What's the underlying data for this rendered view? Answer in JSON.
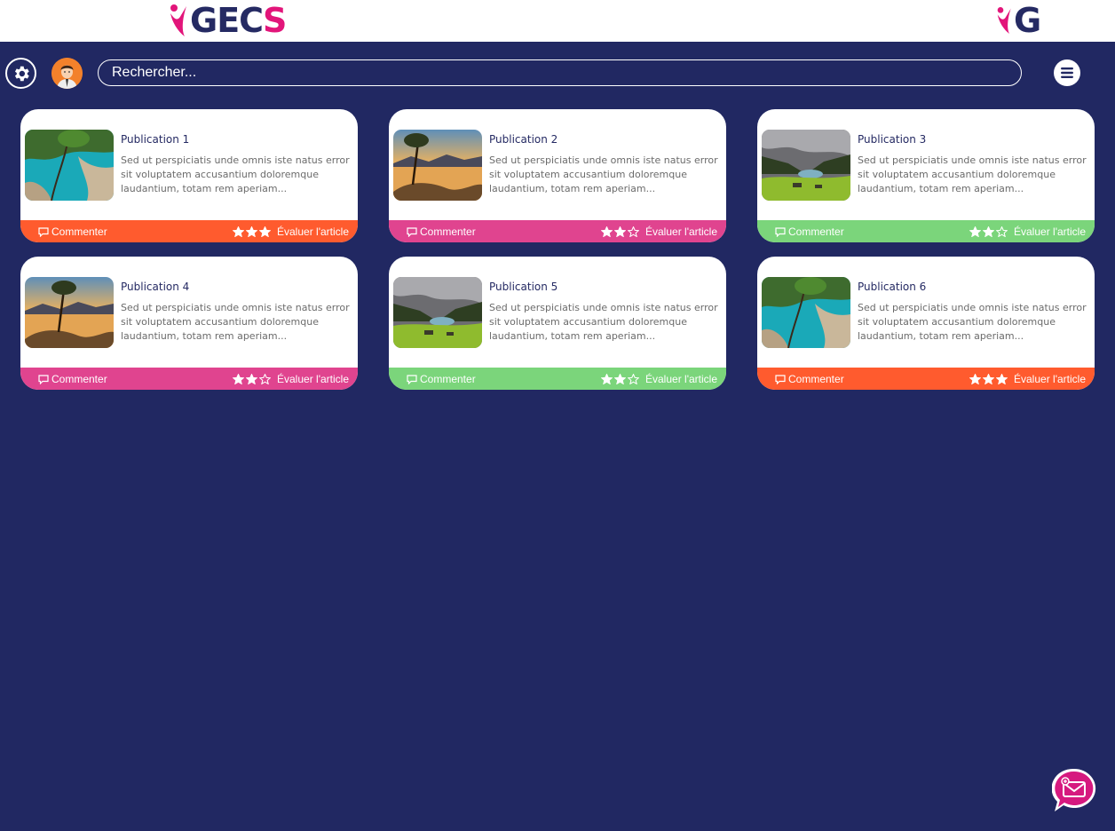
{
  "header": {
    "logo_text_dark": "GEC",
    "logo_text_pink": "S",
    "logo_small_text": "G"
  },
  "toolbar": {
    "search_placeholder": "Rechercher...",
    "settings_icon": "gear-icon",
    "menu_icon": "hamburger-icon"
  },
  "colors": {
    "background": "#212862",
    "orange": "#ff5b2e",
    "pink": "#e0448f",
    "green": "#7bd57b",
    "brand_pink": "#e2157a",
    "brand_navy": "#252a63"
  },
  "publications": [
    {
      "title": "Publication 1",
      "description": "Sed ut perspiciatis unde omnis iste natus error sit voluptatem accusantium doloremque laudantium, totam rem aperiam...",
      "comment_label": "Commenter",
      "rate_label": "Évaluer l'article",
      "rating": 3,
      "max_rating": 3,
      "footer_color": "#ff5b2e",
      "image": "coast-cove"
    },
    {
      "title": "Publication 2",
      "description": "Sed ut perspiciatis unde omnis iste natus error sit voluptatem accusantium doloremque laudantium, totam rem aperiam...",
      "comment_label": "Commenter",
      "rate_label": "Évaluer l'article",
      "rating": 2,
      "max_rating": 3,
      "footer_color": "#e0448f",
      "image": "lake-sunset"
    },
    {
      "title": "Publication 3",
      "description": "Sed ut perspiciatis unde omnis iste natus error sit voluptatem accusantium doloremque laudantium, totam rem aperiam...",
      "comment_label": "Commenter",
      "rate_label": "Évaluer l'article",
      "rating": 2,
      "max_rating": 3,
      "footer_color": "#7bd57b",
      "image": "green-valley"
    },
    {
      "title": "Publication 4",
      "description": "Sed ut perspiciatis unde omnis iste natus error sit voluptatem accusantium doloremque laudantium, totam rem aperiam...",
      "comment_label": "Commenter",
      "rate_label": "Évaluer l'article",
      "rating": 2,
      "max_rating": 3,
      "footer_color": "#e0448f",
      "image": "lake-sunset"
    },
    {
      "title": "Publication 5",
      "description": "Sed ut perspiciatis unde omnis iste natus error sit voluptatem accusantium doloremque laudantium, totam rem aperiam...",
      "comment_label": "Commenter",
      "rate_label": "Évaluer l'article",
      "rating": 2,
      "max_rating": 3,
      "footer_color": "#7bd57b",
      "image": "green-valley"
    },
    {
      "title": "Publication 6",
      "description": "Sed ut perspiciatis unde omnis iste natus error sit voluptatem accusantium doloremque laudantium, totam rem aperiam...",
      "comment_label": "Commenter",
      "rate_label": "Évaluer l'article",
      "rating": 3,
      "max_rating": 3,
      "footer_color": "#ff5b2e",
      "image": "coast-cove"
    }
  ],
  "fab": {
    "icon": "message-icon"
  }
}
